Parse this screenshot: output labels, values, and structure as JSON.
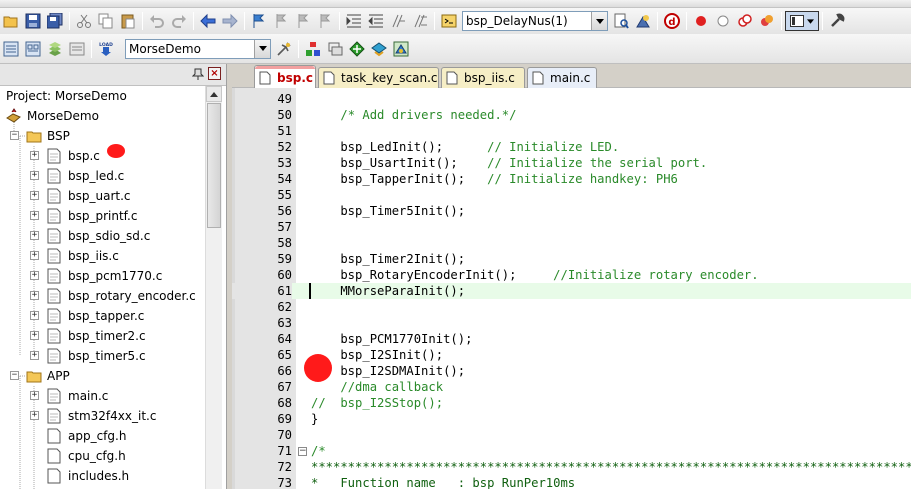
{
  "toolbar": {
    "function_combo": "bsp_DelayNus(1)",
    "target_combo": "MorseDemo",
    "load_label": "LOAD"
  },
  "project": {
    "title": "Project: MorseDemo",
    "items": [
      {
        "label": "MorseDemo",
        "type": "root"
      },
      {
        "label": "BSP",
        "type": "group"
      },
      {
        "label": "bsp.c",
        "type": "file"
      },
      {
        "label": "bsp_led.c",
        "type": "file"
      },
      {
        "label": "bsp_uart.c",
        "type": "file"
      },
      {
        "label": "bsp_printf.c",
        "type": "file"
      },
      {
        "label": "bsp_sdio_sd.c",
        "type": "file"
      },
      {
        "label": "bsp_iis.c",
        "type": "file"
      },
      {
        "label": "bsp_pcm1770.c",
        "type": "file"
      },
      {
        "label": "bsp_rotary_encoder.c",
        "type": "file"
      },
      {
        "label": "bsp_tapper.c",
        "type": "file"
      },
      {
        "label": "bsp_timer2.c",
        "type": "file"
      },
      {
        "label": "bsp_timer5.c",
        "type": "file"
      },
      {
        "label": "APP",
        "type": "group"
      },
      {
        "label": "main.c",
        "type": "file"
      },
      {
        "label": "stm32f4xx_it.c",
        "type": "file"
      },
      {
        "label": "app_cfg.h",
        "type": "header"
      },
      {
        "label": "cpu_cfg.h",
        "type": "header"
      },
      {
        "label": "includes.h",
        "type": "header"
      }
    ]
  },
  "tabs": [
    {
      "label": "bsp.c",
      "active": true
    },
    {
      "label": "task_key_scan.c",
      "active": false
    },
    {
      "label": "bsp_iis.c",
      "active": false
    },
    {
      "label": "main.c",
      "active": false
    }
  ],
  "editor": {
    "lines": [
      {
        "n": "49",
        "code": "",
        "comment": ""
      },
      {
        "n": "50",
        "code": "    ",
        "comment": "/* Add drivers needed.*/"
      },
      {
        "n": "51",
        "code": "",
        "comment": ""
      },
      {
        "n": "52",
        "code": "    bsp_LedInit();      ",
        "comment": "// Initialize LED."
      },
      {
        "n": "53",
        "code": "    bsp_UsartInit();    ",
        "comment": "// Initialize the serial port."
      },
      {
        "n": "54",
        "code": "    bsp_TapperInit();   ",
        "comment": "// Initialize handkey: PH6"
      },
      {
        "n": "55",
        "code": "",
        "comment": ""
      },
      {
        "n": "56",
        "code": "    bsp_Timer5Init();",
        "comment": ""
      },
      {
        "n": "57",
        "code": "",
        "comment": ""
      },
      {
        "n": "58",
        "code": "",
        "comment": ""
      },
      {
        "n": "59",
        "code": "    bsp_Timer2Init();",
        "comment": ""
      },
      {
        "n": "60",
        "code": "    bsp_RotaryEncoderInit();     ",
        "comment": "//Initialize rotary encoder."
      },
      {
        "n": "61",
        "code": "    MMorseParaInit();",
        "comment": ""
      },
      {
        "n": "62",
        "code": "",
        "comment": ""
      },
      {
        "n": "63",
        "code": "",
        "comment": ""
      },
      {
        "n": "64",
        "code": "    bsp_PCM1770Init();",
        "comment": ""
      },
      {
        "n": "65",
        "code": "    bsp_I2SInit();",
        "comment": ""
      },
      {
        "n": "66",
        "code": "    bsp_I2SDMAInit();",
        "comment": ""
      },
      {
        "n": "67",
        "code": "    ",
        "comment": "//dma callback"
      },
      {
        "n": "68",
        "code": "",
        "comment": "//  bsp_I2SStop();"
      },
      {
        "n": "69",
        "code": "}",
        "comment": ""
      },
      {
        "n": "70",
        "code": "",
        "comment": ""
      },
      {
        "n": "71",
        "code": "",
        "comment": "/*"
      },
      {
        "n": "72",
        "code": "",
        "comment": "*****************************************************************************************************"
      },
      {
        "n": "73",
        "code": "",
        "comment": "*   Function name   : bsp RunPer10ms"
      }
    ]
  }
}
